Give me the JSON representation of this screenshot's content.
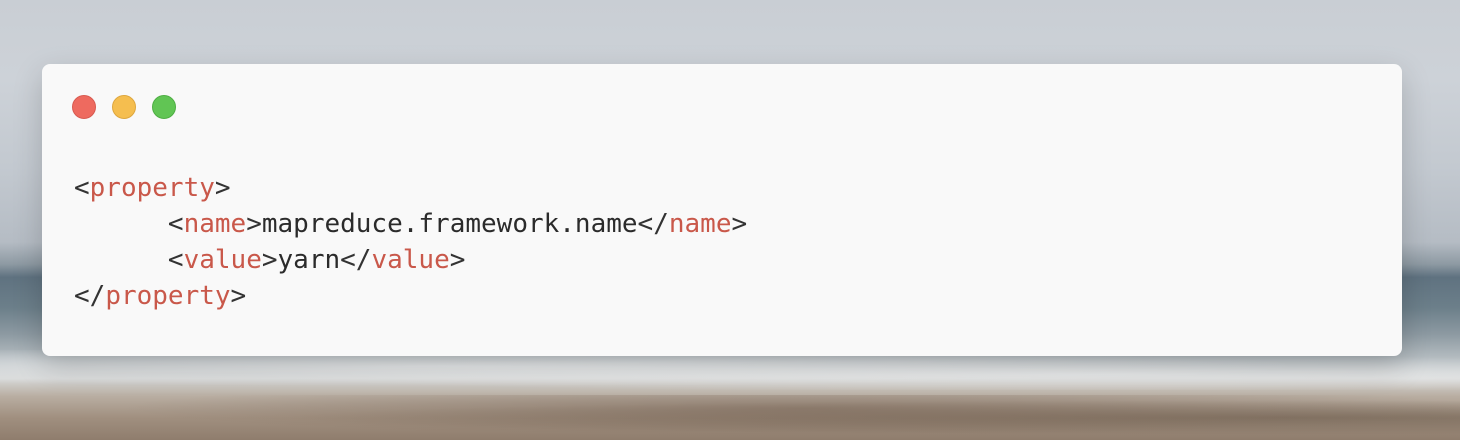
{
  "window": {
    "buttons": {
      "close": "close-button",
      "minimize": "minimize-button",
      "maximize": "maximize-button"
    },
    "colors": {
      "close": "#ee6a5f",
      "minimize": "#f5be4f",
      "maximize": "#61c554",
      "tag": "#c9584a",
      "text": "#2b2b2b",
      "background": "#f9f9f9"
    }
  },
  "code": {
    "language": "xml",
    "lines": [
      {
        "indent": "",
        "open_bracket": "<",
        "tag": "property",
        "close_bracket": ">"
      },
      {
        "indent": "      ",
        "open_tag": "name",
        "value": "mapreduce.framework.name",
        "close_tag": "name"
      },
      {
        "indent": "      ",
        "open_tag": "value",
        "value": "yarn",
        "close_tag": "value"
      },
      {
        "indent": "",
        "close_tag": "property"
      }
    ]
  }
}
